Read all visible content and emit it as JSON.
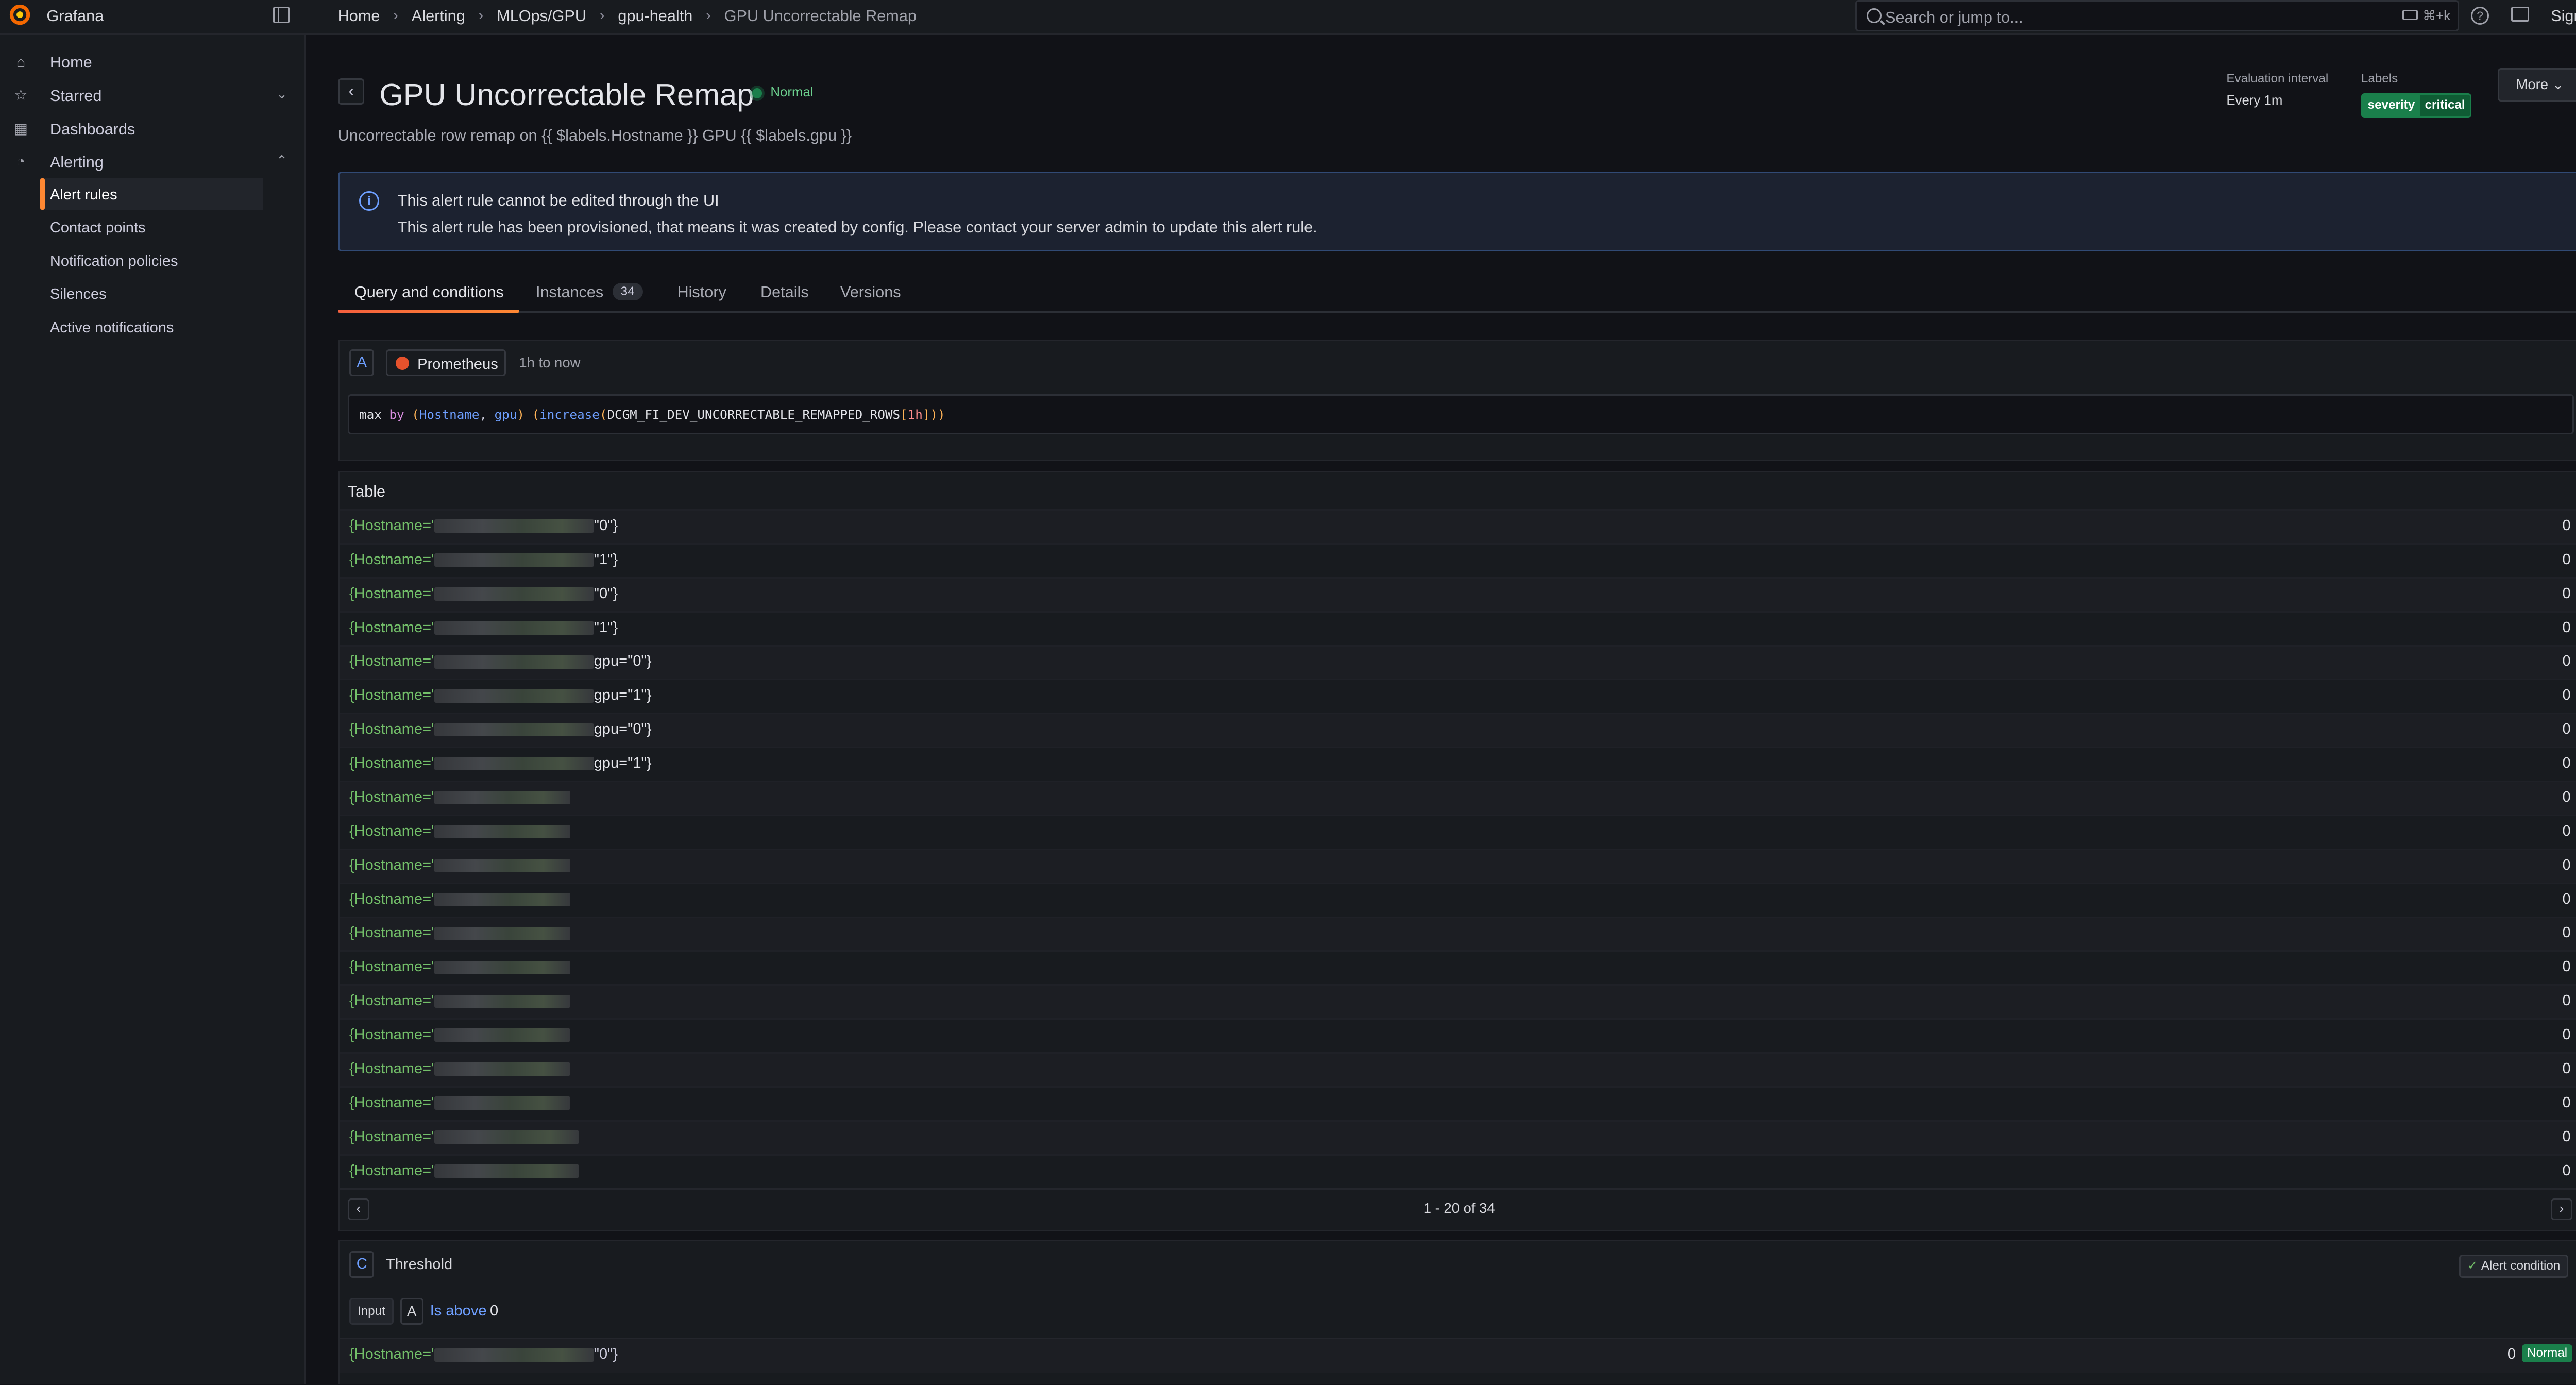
{
  "app": {
    "name": "Grafana",
    "sign_in": "Sign in"
  },
  "breadcrumb": [
    "Home",
    "Alerting",
    "MLOps/GPU",
    "gpu-health",
    "GPU Uncorrectable Remap"
  ],
  "search": {
    "placeholder": "Search or jump to...",
    "shortcut": "⌘+k"
  },
  "sidebar": {
    "items": [
      {
        "label": "Home",
        "icon": "home-icon"
      },
      {
        "label": "Starred",
        "icon": "star-icon"
      },
      {
        "label": "Dashboards",
        "icon": "dashboards-icon"
      },
      {
        "label": "Alerting",
        "icon": "bell-icon"
      }
    ],
    "alerting_children": [
      "Alert rules",
      "Contact points",
      "Notification policies",
      "Silences",
      "Active notifications"
    ],
    "active_child": "Alert rules"
  },
  "rule": {
    "title": "GPU Uncorrectable Remap",
    "state": "Normal",
    "summary": "Uncorrectable row remap on {{ $labels.Hostname }} GPU {{ $labels.gpu }}",
    "evaluation_interval_label": "Evaluation interval",
    "evaluation_interval": "Every 1m",
    "labels_label": "Labels",
    "label_key": "severity",
    "label_value": "critical",
    "more_button": "More"
  },
  "banner": {
    "title": "This alert rule cannot be edited through the UI",
    "text": "This alert rule has been provisioned, that means it was created by config. Please contact your server admin to update this alert rule."
  },
  "tabs": [
    {
      "label": "Query and conditions",
      "active": true
    },
    {
      "label": "Instances",
      "count": "34"
    },
    {
      "label": "History"
    },
    {
      "label": "Details"
    },
    {
      "label": "Versions"
    }
  ],
  "query": {
    "ref": "A",
    "datasource": "Prometheus",
    "time_range": "1h to now",
    "expression": "max by (Hostname, gpu) (increase(DCGM_FI_DEV_UNCORRECTABLE_REMAPPED_ROWS[1h]))"
  },
  "table": {
    "title": "Table",
    "rows": [
      {
        "prefix": "{Hostname='",
        "suffix": "\"0\"}",
        "value": "0"
      },
      {
        "prefix": "{Hostname='",
        "suffix": "\"1\"}",
        "value": "0"
      },
      {
        "prefix": "{Hostname='",
        "suffix": "\"0\"}",
        "value": "0"
      },
      {
        "prefix": "{Hostname='",
        "suffix": "\"1\"}",
        "value": "0"
      },
      {
        "prefix": "{Hostname='",
        "suffix": "gpu=\"0\"}",
        "value": "0"
      },
      {
        "prefix": "{Hostname='",
        "suffix": "gpu=\"1\"}",
        "value": "0"
      },
      {
        "prefix": "{Hostname='",
        "suffix": "gpu=\"0\"}",
        "value": "0"
      },
      {
        "prefix": "{Hostname='",
        "suffix": "gpu=\"1\"}",
        "value": "0"
      },
      {
        "prefix": "{Hostname='",
        "suffix": "",
        "value": "0"
      },
      {
        "prefix": "{Hostname='",
        "suffix": "",
        "value": "0"
      },
      {
        "prefix": "{Hostname='",
        "suffix": "",
        "value": "0"
      },
      {
        "prefix": "{Hostname='",
        "suffix": "",
        "value": "0"
      },
      {
        "prefix": "{Hostname='",
        "suffix": "",
        "value": "0"
      },
      {
        "prefix": "{Hostname='",
        "suffix": "",
        "value": "0"
      },
      {
        "prefix": "{Hostname='",
        "suffix": "",
        "value": "0"
      },
      {
        "prefix": "{Hostname='",
        "suffix": "",
        "value": "0"
      },
      {
        "prefix": "{Hostname='",
        "suffix": "",
        "value": "0"
      },
      {
        "prefix": "{Hostname='",
        "suffix": "",
        "value": "0"
      },
      {
        "prefix": "{Hostname='",
        "suffix": "",
        "value": "0"
      },
      {
        "prefix": "{Hostname='",
        "suffix": "",
        "value": "0"
      }
    ],
    "pagination": "1 - 20 of 34"
  },
  "threshold": {
    "ref": "C",
    "type": "Threshold",
    "alert_condition": "Alert condition",
    "input_label": "Input",
    "input_ref": "A",
    "operator": "Is above",
    "value": "0",
    "result": {
      "prefix": "{Hostname='",
      "suffix": "\"0\"}",
      "value": "0",
      "state": "Normal"
    }
  },
  "colors": {
    "accent": "#ff8833",
    "normal": "#1a7f4b",
    "info": "#6e9fff",
    "label_green": "#73bf69"
  }
}
